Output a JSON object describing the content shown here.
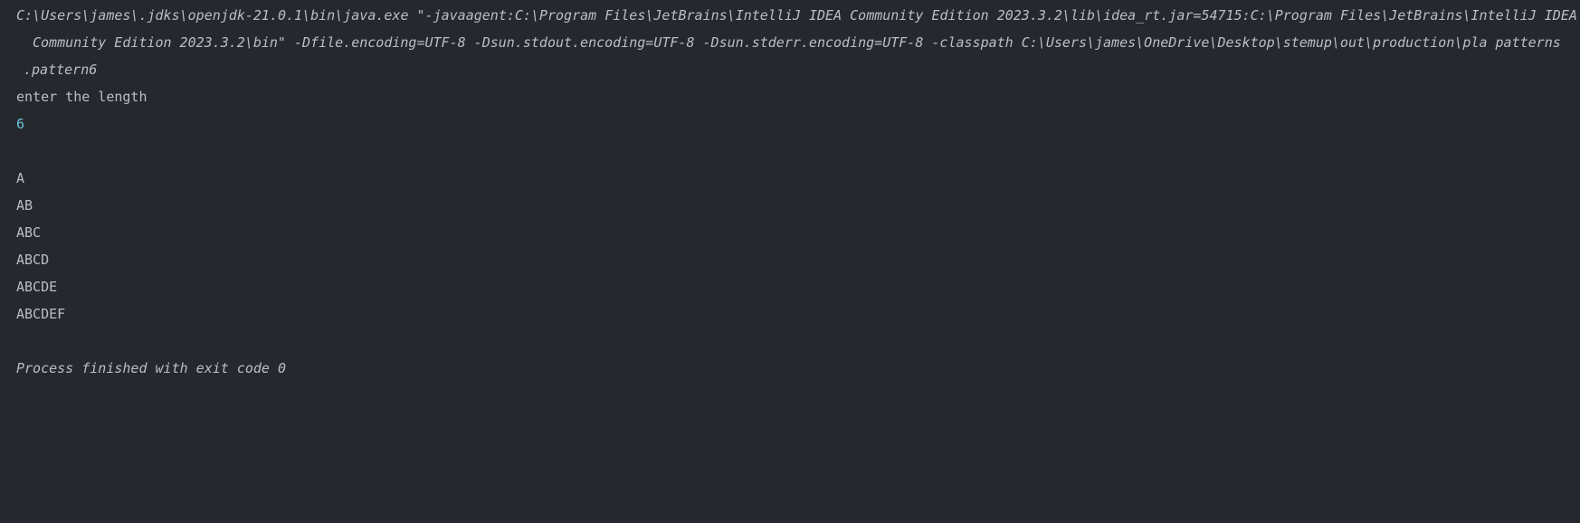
{
  "console": {
    "command_lines": [
      "C:\\Users\\james\\.jdks\\openjdk-21.0.1\\bin\\java.exe \"-javaagent:C:\\Program Files\\JetBrains\\IntelliJ IDEA Community Edition 2023.3.2\\lib\\idea_rt.jar=54715:C:\\Program Files\\JetBrains\\IntelliJ IDEA",
      "Community Edition 2023.3.2\\bin\" -Dfile.encoding=UTF-8 -Dsun.stdout.encoding=UTF-8 -Dsun.stderr.encoding=UTF-8 -classpath C:\\Users\\james\\OneDrive\\Desktop\\stemup\\out\\production\\pla patterns",
      ".pattern6"
    ],
    "prompt": "enter the length",
    "user_input": "6",
    "output_lines": [
      "A",
      "AB",
      "ABC",
      "ABCD",
      "ABCDE",
      "ABCDEF"
    ],
    "exit_message": "Process finished with exit code 0"
  }
}
